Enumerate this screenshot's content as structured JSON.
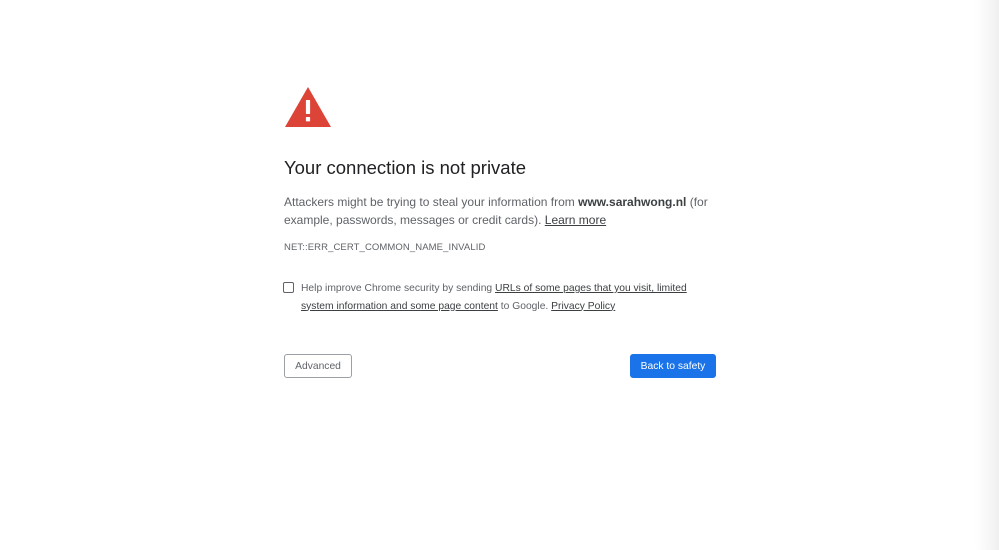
{
  "icon": {
    "name": "warning-triangle-icon",
    "color": "#db4437"
  },
  "title": "Your connection is not private",
  "body": {
    "part1": "Attackers might be trying to steal your information from ",
    "domain": "www.sarahwong.nl",
    "part2": " (for example, passwords, messages or credit cards). ",
    "learn_more": "Learn more"
  },
  "error_code": "NET::ERR_CERT_COMMON_NAME_INVALID",
  "optin": {
    "prefix": "Help improve Chrome security by sending ",
    "link": "URLs of some pages that you visit, limited system information and some page content",
    "middle": " to Google. ",
    "privacy_link": "Privacy Policy"
  },
  "buttons": {
    "advanced": "Advanced",
    "back_to_safety": "Back to safety"
  },
  "colors": {
    "primary_button": "#1a73e8",
    "warning": "#db4437"
  }
}
